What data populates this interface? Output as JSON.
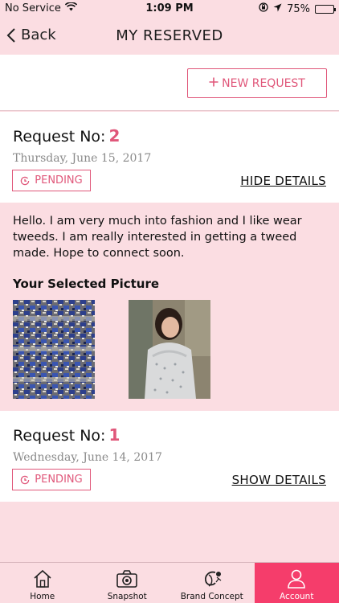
{
  "status_bar": {
    "carrier": "No Service",
    "time": "1:09 PM",
    "battery": "75%",
    "battery_level": 0.75
  },
  "nav": {
    "back_label": "Back",
    "title": "MY RESERVED"
  },
  "toolbar": {
    "new_request_label": "NEW REQUEST"
  },
  "requests": [
    {
      "title_label": "Request No:",
      "number": "2",
      "date": "Thursday, June 15, 2017",
      "status": "PENDING",
      "details_action": "HIDE DETAILS",
      "message": "Hello. I am very much into fashion and I like wear tweeds. I am really interested in getting a tweed made. Hope to connect soon.",
      "selected_heading": "Your Selected Picture"
    },
    {
      "title_label": "Request No:",
      "number": "1",
      "date": "Wednesday, June 14, 2017",
      "status": "PENDING",
      "details_action": "SHOW DETAILS"
    }
  ],
  "tabs": [
    {
      "label": "Home",
      "icon": "home-icon",
      "active": false
    },
    {
      "label": "Snapshot",
      "icon": "camera-icon",
      "active": false
    },
    {
      "label": "Brand Concept",
      "icon": "brand-logo-icon",
      "active": false
    },
    {
      "label": "Account",
      "icon": "user-icon",
      "active": true
    }
  ],
  "colors": {
    "accent": "#e0577a",
    "tab_active": "#f53d6b",
    "background": "#fbdde2"
  }
}
